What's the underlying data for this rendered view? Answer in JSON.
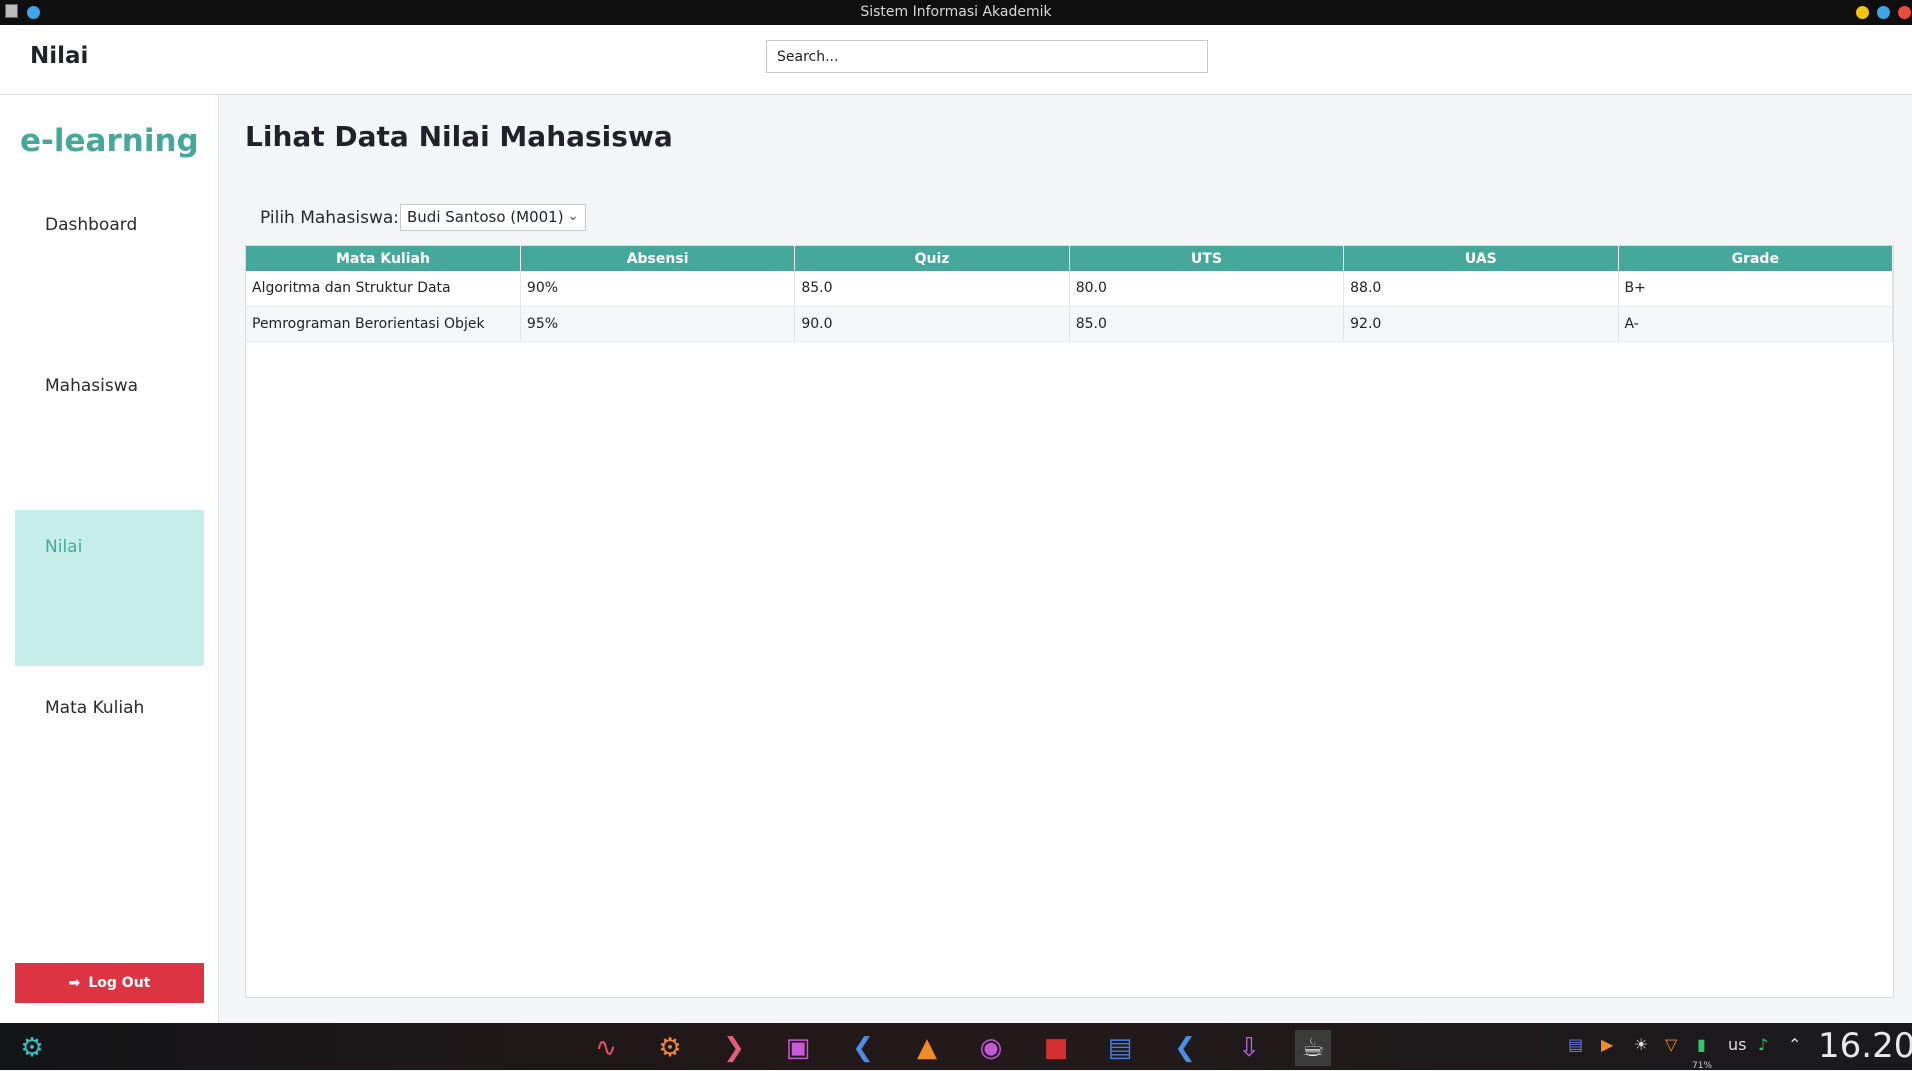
{
  "window": {
    "title": "Sistem Informasi Akademik"
  },
  "header": {
    "page_name": "Nilai",
    "search_placeholder": "Search..."
  },
  "sidebar": {
    "brand": "e-learning",
    "items": [
      {
        "label": "Dashboard",
        "active": false
      },
      {
        "label": "Mahasiswa",
        "active": false
      },
      {
        "label": "Nilai",
        "active": true
      },
      {
        "label": "Mata Kuliah",
        "active": false
      }
    ],
    "logout_label": "Log Out"
  },
  "main": {
    "title": "Lihat Data Nilai Mahasiswa",
    "select_label": "Pilih Mahasiswa:",
    "selected_student": "Budi Santoso (M001)",
    "table": {
      "columns": [
        "Mata Kuliah",
        "Absensi",
        "Quiz",
        "UTS",
        "UAS",
        "Grade"
      ],
      "rows": [
        [
          "Algoritma dan Struktur Data",
          "90%",
          "85.0",
          "80.0",
          "88.0",
          "B+"
        ],
        [
          "Pemrograman Berorientasi Objek",
          "95%",
          "90.0",
          "85.0",
          "92.0",
          "A-"
        ]
      ]
    }
  },
  "taskbar": {
    "apps": [
      "launcher-icon",
      "system-monitor-icon",
      "settings-icon",
      "terminal-icon",
      "files-icon",
      "vscode-icon",
      "brave-icon",
      "steam-icon",
      "dota-icon",
      "game-controller-icon",
      "vscode-alt-icon",
      "downloader-icon",
      "java-app-icon"
    ],
    "tray_icons": [
      "clipboard-icon",
      "media-icon",
      "brightness-icon",
      "wifi-icon",
      "battery-icon",
      "volume-icon",
      "expand-tray-icon"
    ],
    "keyboard_layout": "us",
    "clock": "16.20",
    "battery_percent": "71%"
  },
  "colors": {
    "accent": "#45a89b",
    "active_bg": "#c6eee8",
    "danger": "#dd3444"
  }
}
